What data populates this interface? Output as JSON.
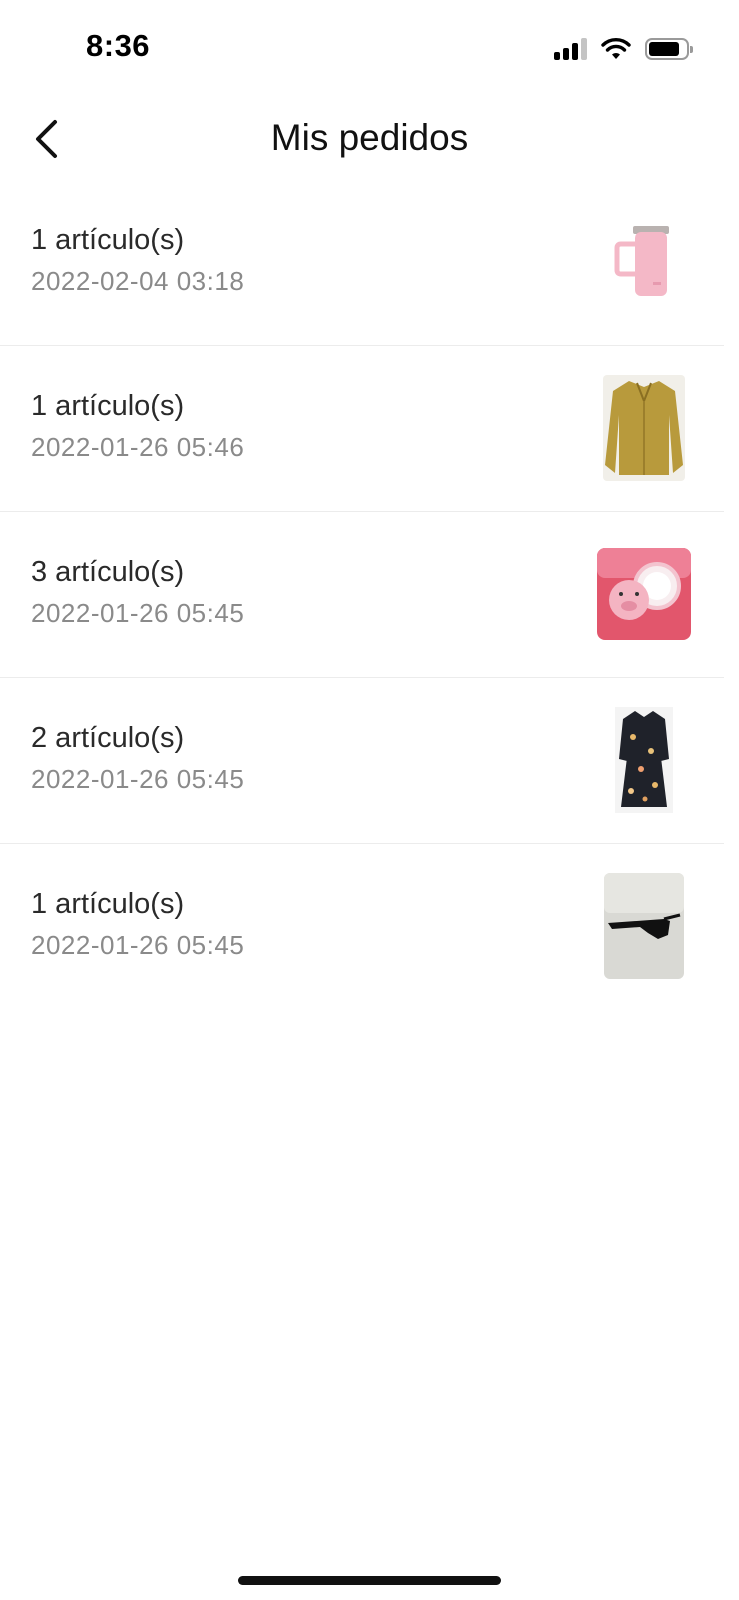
{
  "status_bar": {
    "time": "8:36",
    "icons": [
      "signal-icon",
      "wifi-icon",
      "battery-icon"
    ]
  },
  "header": {
    "title": "Mis pedidos",
    "back_icon": "chevron-left-icon"
  },
  "orders": [
    {
      "count": "1 artículo(s)",
      "date": "2022-02-04 03:18",
      "thumbnail": "pink-tumbler"
    },
    {
      "count": "1 artículo(s)",
      "date": "2022-01-26 05:46",
      "thumbnail": "gold-blouse"
    },
    {
      "count": "3 artículo(s)",
      "date": "2022-01-26 05:45",
      "thumbnail": "pink-mirror"
    },
    {
      "count": "2 artículo(s)",
      "date": "2022-01-26 05:45",
      "thumbnail": "floral-dress"
    },
    {
      "count": "1 artículo(s)",
      "date": "2022-01-26 05:45",
      "thumbnail": "sunglasses"
    }
  ],
  "colors": {
    "text_primary": "#2a2a2a",
    "text_secondary": "#8a8a8a",
    "divider": "#ececec"
  }
}
